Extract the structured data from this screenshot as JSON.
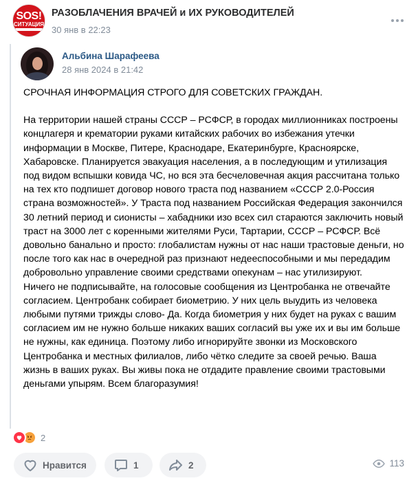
{
  "group": {
    "avatar_text_top": "SOS!",
    "avatar_text_bottom": "СИТУАЦИЯ КРИТИЧЕСКАЯ",
    "name": "РАЗОБЛАЧЕНИЯ ВРАЧЕЙ и ИХ РУКОВОДИТЕЛЕЙ",
    "date": "30 янв в 22:23"
  },
  "repost": {
    "author_name": "Альбина Шарафеева",
    "author_date": "28 янв 2024 в 21:42",
    "paragraphs": [
      "СРОЧНАЯ ИНФОРМАЦИЯ СТРОГО ДЛЯ СОВЕТСКИХ ГРАЖДАН.",
      "",
      "На территории нашей страны СССР – РСФСР, в городах миллионниках построены концлагеря и крематории руками китайских рабочих во избежания утечки информации в Москве, Питере, Краснодаре, Екатеринбурге, Красноярске, Хабаровске. Планируется эвакуация населения, а в последующим и утилизация под видом вспышки ковида ЧС, но вся эта бесчеловечная акция рассчитана только на тех кто подпишет договор нового траста под названием «СССР 2.0-Россия страна возможностей». У Траста под названием Российская Федерация закончился 30 летний период и сионисты – хабадники изо всех сил стараются заключить новый траст на 3000 лет с коренными жителями Руси, Тартарии, СССР – РСФСР. Всё довольно банально и просто: глобалистам нужны от нас наши трастовые деньги, но после того как нас в очередной раз признают недееспособными и мы передадим добровольно управление своими средствами опекунам – нас утилизируют.",
      "Ничего не подписывайте, на голосовые сообщения из Центробанка не отвечайте согласием. Центробанк собирает биометрию. У них цель выудить из человека любыми путями трижды слово- Да. Когда биометрия у них будет на руках с вашим согласием им не нужно больше никаких ваших согласий вы уже их и вы им больше не нужны, как единица. Поэтому либо игнорируйте звонки из Московского Центробанка и местных филиалов, либо чётко следите за своей речью. Ваша жизнь в ваших руках. Вы живы пока не отдадите правление своими трастовыми деньгами упырям. Всем благоразумия!"
    ]
  },
  "reactions": {
    "count": "2",
    "icons": [
      "heart-reaction-icon",
      "angry-reaction-icon"
    ]
  },
  "actions": {
    "like_label": "Нравится",
    "comments_count": "1",
    "shares_count": "2",
    "views_count": "113"
  },
  "colors": {
    "link": "#2a5885",
    "muted": "#818c99",
    "button_bg": "#f2f3f5",
    "heart": "#ff3347",
    "angry": "#f7a13b"
  }
}
